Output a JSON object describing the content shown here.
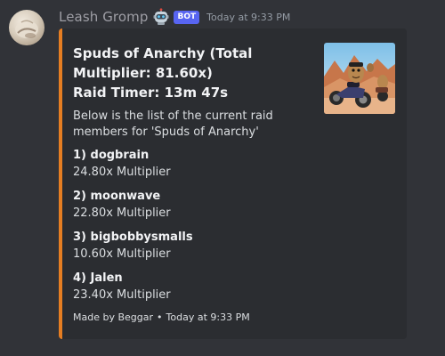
{
  "message": {
    "username": "Leash Gromp",
    "emoji_icon": "robot-emoji",
    "bot_badge": "BOT",
    "timestamp": "Today at 9:33 PM"
  },
  "embed": {
    "accent_color": "#e67e22",
    "title_line1": "Spuds of Anarchy (Total Multiplier: 81.60x)",
    "title_line2": "Raid Timer: 13m 47s",
    "description": "Below is the list of the current raid members for 'Spuds of Anarchy'",
    "members": [
      {
        "name": "1) dogbrain",
        "multiplier": "24.80x Multiplier"
      },
      {
        "name": "2) moonwave",
        "multiplier": "22.80x Multiplier"
      },
      {
        "name": "3) bigbobbysmalls",
        "multiplier": "10.60x Multiplier"
      },
      {
        "name": "4) Jalen",
        "multiplier": "23.40x Multiplier"
      }
    ],
    "footer_text": "Made by Beggar",
    "footer_separator": "•",
    "footer_time": "Today at 9:33 PM"
  },
  "colors": {
    "background": "#313338",
    "embed_background": "#2b2d31",
    "bot_badge": "#5865f2"
  }
}
